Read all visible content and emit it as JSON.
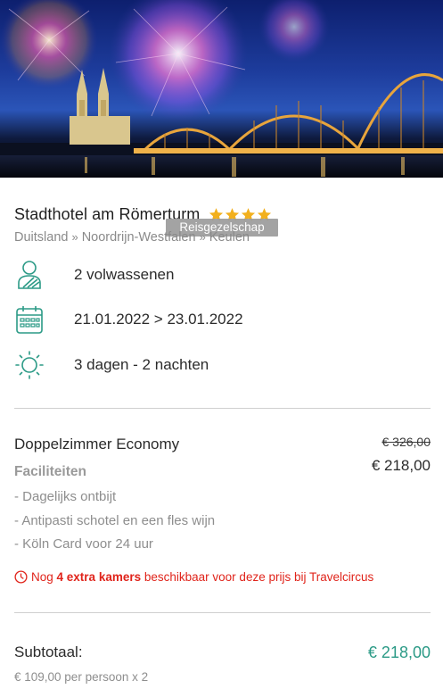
{
  "hotel": {
    "name": "Stadthotel am Römerturm",
    "star_rating": 4,
    "star_color": "#f2b01e",
    "tooltip": "Reisgezelschap"
  },
  "breadcrumb": {
    "items": [
      "Duitsland",
      "Noordrijn-Westfalen",
      "Keulen"
    ],
    "separator": "»"
  },
  "trip": {
    "travellers": "2 volwassenen",
    "dates": "21.01.2022 > 23.01.2022",
    "duration": "3 dagen - 2 nachten",
    "icon_color": "#2b9a86",
    "icons": [
      "person-icon",
      "calendar-icon",
      "sun-icon"
    ]
  },
  "room": {
    "name": "Doppelzimmer Economy",
    "price_old": "€ 326,00",
    "price_new": "€ 218,00",
    "facilities_title": "Faciliteiten",
    "facilities": [
      "- Dagelijks ontbijt",
      "- Antipasti schotel en een fles wijn",
      "- Köln Card voor 24 uur"
    ]
  },
  "availability": {
    "prefix": "Nog",
    "highlight": "4 extra kamers",
    "suffix": "beschikbaar voor deze prijs bij Travelcircus",
    "color": "#e0241b"
  },
  "summary": {
    "subtotal_label": "Subtotaal:",
    "subtotal_value": "€ 218,00",
    "per_person": "€ 109,00 per persoon x 2",
    "accent": "#2b9a86"
  }
}
